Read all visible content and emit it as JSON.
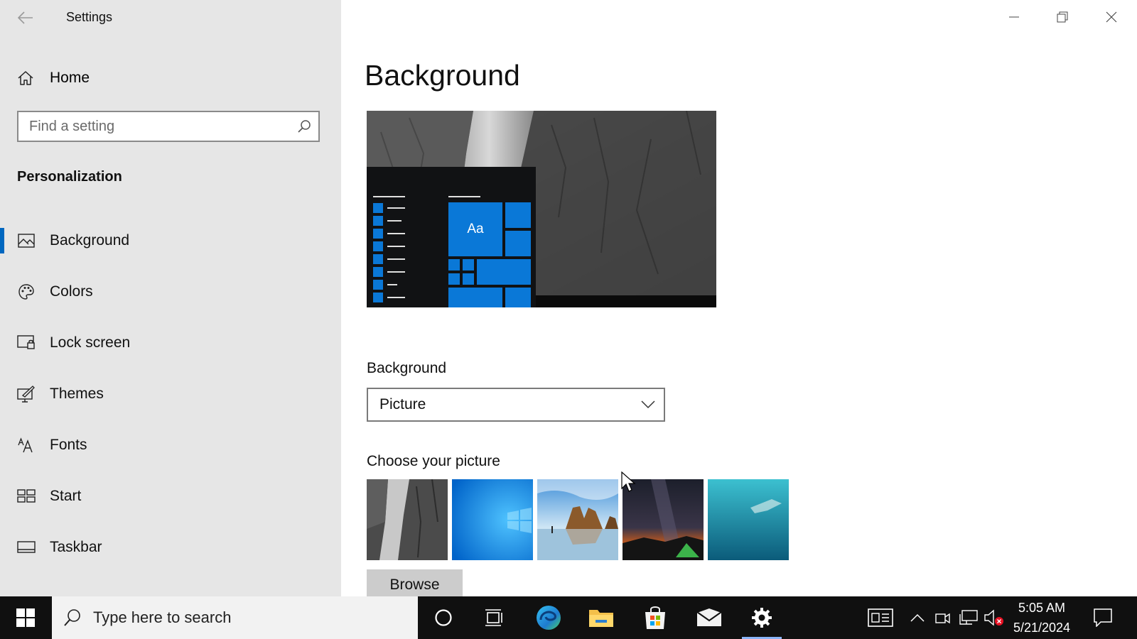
{
  "window": {
    "title": "Settings",
    "controls": {
      "minimize_icon": "minimize-icon",
      "restore_icon": "restore-icon",
      "close_icon": "close-icon"
    }
  },
  "sidebar": {
    "home_label": "Home",
    "search_placeholder": "Find a setting",
    "section_title": "Personalization",
    "items": [
      {
        "label": "Background",
        "icon": "picture-icon",
        "active": true
      },
      {
        "label": "Colors",
        "icon": "palette-icon",
        "active": false
      },
      {
        "label": "Lock screen",
        "icon": "lock-screen-icon",
        "active": false
      },
      {
        "label": "Themes",
        "icon": "themes-icon",
        "active": false
      },
      {
        "label": "Fonts",
        "icon": "fonts-icon",
        "active": false
      },
      {
        "label": "Start",
        "icon": "start-icon",
        "active": false
      },
      {
        "label": "Taskbar",
        "icon": "taskbar-icon",
        "active": false
      }
    ]
  },
  "main": {
    "page_title": "Background",
    "preview_tile_text": "Aa",
    "background_label": "Background",
    "background_value": "Picture",
    "choose_label": "Choose your picture",
    "thumbnails": [
      "rock-cliff",
      "windows-blue",
      "beach-rocks",
      "night-sky-tent",
      "underwater-swimmer"
    ],
    "browse_label": "Browse"
  },
  "taskbar": {
    "search_placeholder": "Type here to search",
    "apps": [
      "cortana-icon",
      "task-view-icon",
      "edge-icon",
      "file-explorer-icon",
      "store-icon",
      "mail-icon",
      "settings-icon"
    ],
    "time": "5:05 AM",
    "date": "5/21/2024"
  },
  "colors": {
    "accent": "#0067c0",
    "sidebar_bg": "#e6e6e6",
    "taskbar_bg": "#101010",
    "tile_blue": "#0a78d7"
  }
}
